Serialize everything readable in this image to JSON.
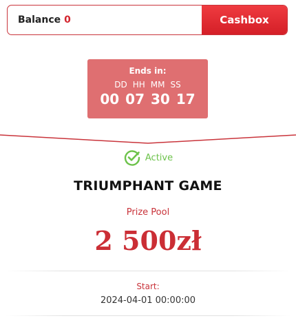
{
  "balance": {
    "label": "Balance",
    "value": "0",
    "cashbox_label": "Cashbox"
  },
  "countdown": {
    "title": "Ends in:",
    "units": [
      "DD",
      "HH",
      "MM",
      "SS"
    ],
    "values": [
      "00",
      "07",
      "30",
      "17"
    ]
  },
  "tournament": {
    "status": "Active",
    "title": "TRIUMPHANT GAME",
    "prize_label": "Prize Pool",
    "prize_amount": "2 500zł",
    "start_label": "Start:",
    "start_value": "2024-04-01 00:00:00"
  },
  "colors": {
    "accent": "#d3262f",
    "countdown_bg": "#df6f71",
    "active_green": "#6cc24a"
  },
  "icons": {
    "status": "check-circle-icon"
  }
}
